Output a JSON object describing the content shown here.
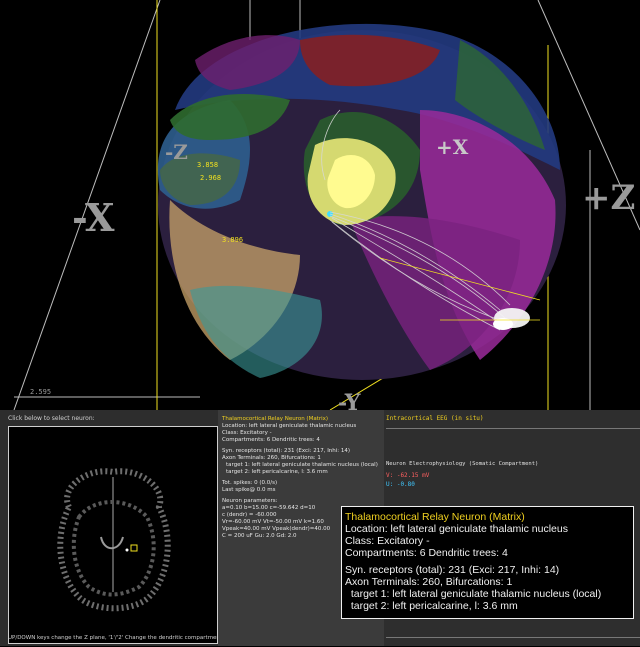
{
  "viewport": {
    "axis_labels": {
      "minus_x": "-X",
      "plus_x": "+X",
      "minus_z": "-Z",
      "plus_z": "+Z",
      "bottom_y": "-Y"
    },
    "coords": {
      "c1": "3.858",
      "c2": "2.968",
      "c3": "3.896",
      "c4": "2.595"
    },
    "colors": {
      "axis_box": "#f0e020",
      "frame_lines": "#c8c8c8",
      "cortex_blue": "#1e3a8a",
      "cortex_green": "#2f6b2f",
      "cortex_magenta": "#9a2a9a",
      "cortex_red": "#8a1f1f",
      "thalamus_yellow": "#f0f070",
      "axon_white": "#f0f0f0"
    }
  },
  "select_panel": {
    "hint": "Click below to select neuron:",
    "footer": "UP/DOWN keys change the Z plane, '1'/'2' Change the dendritic compartment"
  },
  "info_panel": {
    "title": "Thalamocortical Relay Neuron (Matrix)",
    "location": "Location: left lateral geniculate thalamic nucleus",
    "class": "Class: Excitatory -",
    "compartments": "Compartments: 6  Dendritic trees: 4",
    "syn": "Syn. receptors (total): 231 (Exci: 217, Inhi: 14)",
    "axon": "Axon Terminals: 260, Bifurcations: 1",
    "target1": "target 1: left lateral geniculate thalamic nucleus (local)",
    "target2": "target 2: left pericalcarine, l: 3.6 mm",
    "spikes": "Tot. spikes: 0 (0.0/s)",
    "last_spike": "Last spike@ 0.0 ms",
    "params_title": "Neuron parameters:",
    "p1": "a=0.10  b=15.00 c=-59.642  d=10",
    "p2": "c (dendr) = -60.000",
    "p3": "Vr=-60.00 mV  Vt=-50.00 mV  k=1.60",
    "p4": "Vpeak=40.00 mV  Vpeak(dendr)=40.00",
    "p5": "C = 200 uF  Gu: 2.0  Gd: 2.0"
  },
  "eeg_panel": {
    "title": "Intracortical EEG (in situ)",
    "ephys_title": "Neuron Electrophysiology (Somatic Compartment)",
    "v": "V: -62.15 mV",
    "u": "U: -0.80"
  },
  "tooltip": {
    "title": "Thalamocortical Relay Neuron (Matrix)",
    "location": "Location: left lateral geniculate thalamic nucleus",
    "class": "Class: Excitatory -",
    "compartments": "Compartments: 6  Dendritic trees: 4",
    "syn": "Syn. receptors (total): 231 (Exci: 217, Inhi: 14)",
    "axon": "Axon Terminals: 260, Bifurcations: 1",
    "target1": "  target 1: left lateral geniculate thalamic nucleus (local)",
    "target2": "  target 2: left pericalcarine, l: 3.6 mm"
  }
}
